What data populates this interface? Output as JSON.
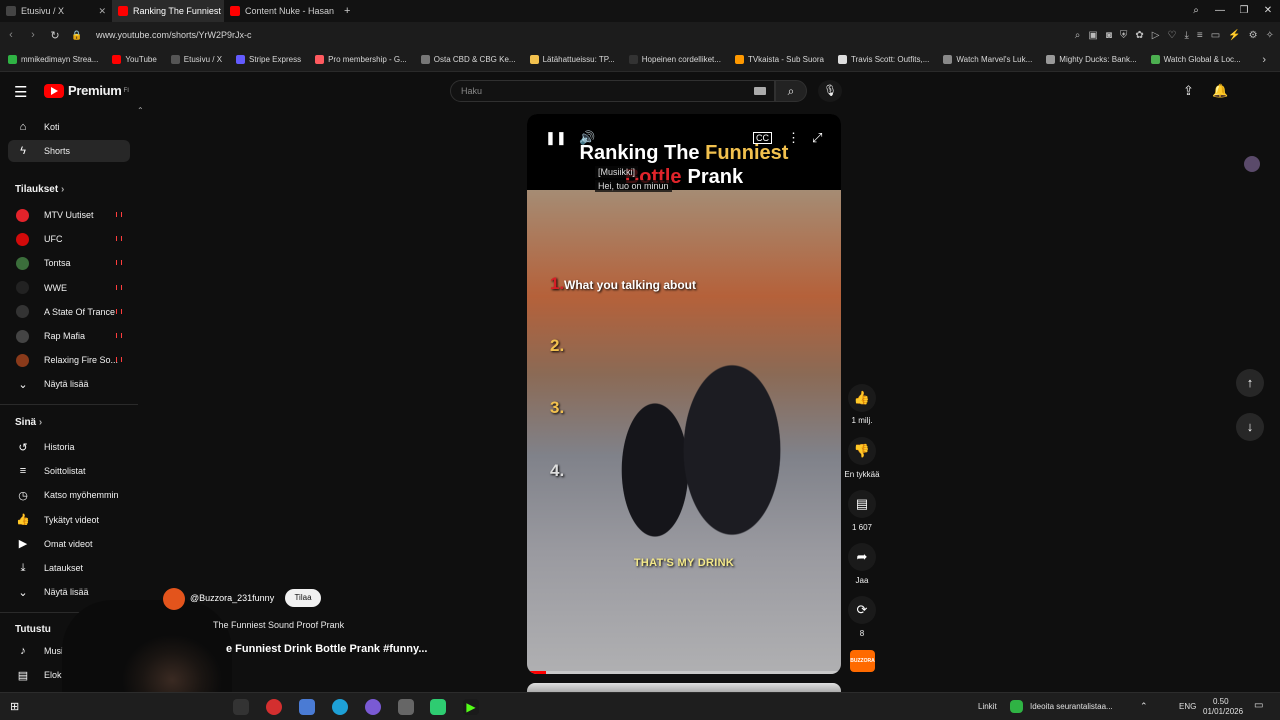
{
  "browser": {
    "tabs": [
      {
        "label": "Etusivu / X",
        "color": "#444444"
      },
      {
        "label": "Ranking The Funniest",
        "color": "#ff0000"
      },
      {
        "label": "Content Nuke - Hasan Pi",
        "color": "#ff0000"
      }
    ],
    "new_tab": "+",
    "url": "www.youtube.com/shorts/YrW2P9rJx-c",
    "bookmarks": [
      {
        "label": "mmikedimayn Strea...",
        "color": "#2fb344"
      },
      {
        "label": "YouTube",
        "color": "#ff0000"
      },
      {
        "label": "Etusivu / X",
        "color": "#555555"
      },
      {
        "label": "Stripe Express",
        "color": "#635bff"
      },
      {
        "label": "Pro membership - G...",
        "color": "#ff5a5f"
      },
      {
        "label": "Osta CBD & CBG Ke...",
        "color": "#777777"
      },
      {
        "label": "Lätähattueissu: TP...",
        "color": "#f2c14e"
      },
      {
        "label": "Hopeinen cordelliket...",
        "color": "#333333"
      },
      {
        "label": "TVkaista - Sub Suora",
        "color": "#ff9900"
      },
      {
        "label": "Travis Scott: Outfits,...",
        "color": "#dddddd"
      },
      {
        "label": "Watch Marvel's Luk...",
        "color": "#888888"
      },
      {
        "label": "Mighty Ducks: Bank...",
        "color": "#999999"
      },
      {
        "label": "Watch Global & Loc...",
        "color": "#4caf50"
      }
    ]
  },
  "header": {
    "logo_text": "Premium",
    "logo_region": "FI",
    "search_placeholder": "Haku"
  },
  "sidebar": {
    "main": [
      {
        "label": "Koti",
        "icon": "⌂"
      },
      {
        "label": "Shorts",
        "icon": "ϟ"
      }
    ],
    "subscriptions_title": "Tilaukset",
    "subscriptions": [
      {
        "label": "MTV Uutiset",
        "color": "#e3232b"
      },
      {
        "label": "UFC",
        "color": "#d20a0a"
      },
      {
        "label": "Tontsa",
        "color": "#3b6e3b"
      },
      {
        "label": "WWE",
        "color": "#222222"
      },
      {
        "label": "A State Of Trance",
        "color": "#333333"
      },
      {
        "label": "Rap Mafia",
        "color": "#444444"
      },
      {
        "label": "Relaxing Fire So...",
        "color": "#8a3a1a"
      }
    ],
    "show_more": "Näytä lisää",
    "you_title": "Sinä",
    "you": [
      {
        "label": "Historia",
        "icon": "↺"
      },
      {
        "label": "Soittolistat",
        "icon": "≡"
      },
      {
        "label": "Katso myöhemmin",
        "icon": "◷"
      },
      {
        "label": "Tykätyt videot",
        "icon": "👍"
      },
      {
        "label": "Omat videot",
        "icon": "▶"
      },
      {
        "label": "Lataukset",
        "icon": "⤓"
      }
    ],
    "show_more2": "Näytä lisää",
    "explore_title": "Tutustu",
    "explore": [
      {
        "label": "Musiikki",
        "icon": "♪"
      },
      {
        "label": "Elokuvat",
        "icon": "▤"
      }
    ]
  },
  "video": {
    "title_line1_a": "Ranking The ",
    "title_line1_b": "Funniest",
    "title_line2_a": "Bottle",
    "title_line2_b": "Prank",
    "caption1": "[Musiikki]",
    "caption2": "Hei, tuo on minun",
    "ranks": [
      "1.",
      "2.",
      "3.",
      "4."
    ],
    "rank1_text": "What you talking about",
    "drink_text": "THAT'S MY DRINK",
    "progress": 0.06
  },
  "actions": {
    "likes": "1 milj.",
    "dislike": "En tykkää",
    "comments": "1 607",
    "share": "Jaa",
    "remix": "8",
    "channel_thumb": "BUZZORA"
  },
  "channel": {
    "handle": "@Buzzora_231funny",
    "subscribe": "Tilaa",
    "subtitle": "The Funniest Sound Proof Prank",
    "title": "e Funniest Drink Bottle Prank #funny..."
  },
  "taskbar": {
    "links": "Linkit",
    "notification": "Ideoita seurantalistaa...",
    "lang": "ENG",
    "time": "0.50",
    "date": "01/01/2026"
  }
}
